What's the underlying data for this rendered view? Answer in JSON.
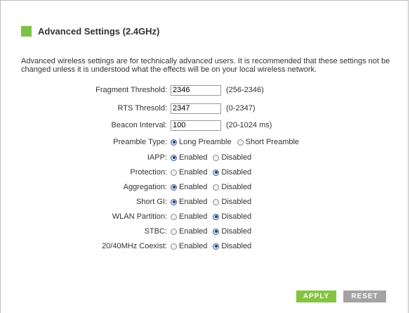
{
  "header": {
    "title": "Advanced Settings (2.4GHz)",
    "accent_color": "#7cc242"
  },
  "description": "Advanced wireless settings are for technically advanced users. It is recommended that these settings not be changed unless it is understood what the effects will be on your local wireless network.",
  "fields": {
    "fragment": {
      "label": "Fragment Threshold:",
      "value": "2346",
      "range": "(256-2346)"
    },
    "rts": {
      "label": "RTS Thresold:",
      "value": "2347",
      "range": "(0-2347)"
    },
    "beacon": {
      "label": "Beacon Interval:",
      "value": "100",
      "range": "(20-1024 ms)"
    }
  },
  "radios": {
    "preamble": {
      "label": "Preamble Type:",
      "opt1": "Long Preamble",
      "opt2": "Short Preamble",
      "selected": "Long Preamble"
    },
    "iapp": {
      "label": "IAPP:",
      "opt1": "Enabled",
      "opt2": "Disabled",
      "selected": "Enabled"
    },
    "protection": {
      "label": "Protection:",
      "opt1": "Enabled",
      "opt2": "Disabled",
      "selected": "Disabled"
    },
    "aggregation": {
      "label": "Aggregation:",
      "opt1": "Enabled",
      "opt2": "Disabled",
      "selected": "Enabled"
    },
    "shortgi": {
      "label": "Short GI:",
      "opt1": "Enabled",
      "opt2": "Disabled",
      "selected": "Enabled"
    },
    "wlanpartition": {
      "label": "WLAN Partition:",
      "opt1": "Enabled",
      "opt2": "Disabled",
      "selected": "Disabled"
    },
    "stbc": {
      "label": "STBC:",
      "opt1": "Enabled",
      "opt2": "Disabled",
      "selected": "Disabled"
    },
    "coexist": {
      "label": "20/40MHz Coexist:",
      "opt1": "Enabled",
      "opt2": "Disabled",
      "selected": "Disabled"
    }
  },
  "buttons": {
    "apply": "APPLY",
    "reset": "RESET",
    "apply_color": "#84c441",
    "reset_color": "#a3a3a3"
  }
}
